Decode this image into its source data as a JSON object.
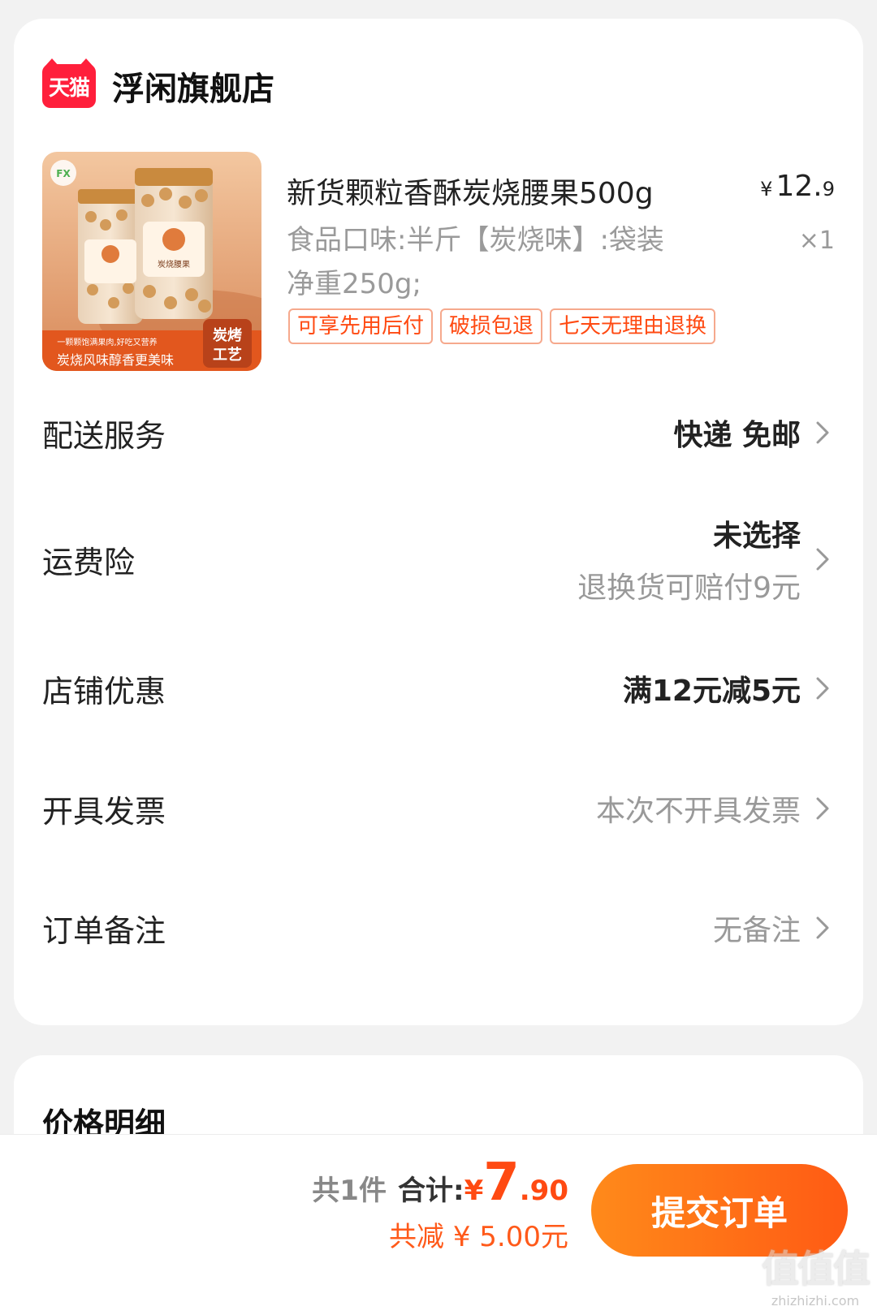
{
  "shop": {
    "badge": "天猫",
    "name": "浮闲旗舰店"
  },
  "product": {
    "title": "新货颗粒香酥炭烧腰果500g",
    "price": {
      "currency": "¥",
      "int": "12.",
      "dec": "9"
    },
    "spec": "食品口味:半斤【炭烧味】:袋装净重250g;",
    "qty": "×1",
    "tags": [
      "可享先用后付",
      "破损包退",
      "七天无理由退换"
    ],
    "image": {
      "jar_label": "炭烧腰果",
      "banner_top": "一颗颗饱满果肉,好吃又营养",
      "banner_bottom": "炭烧风味醇香更美味",
      "badge_line1": "炭烤",
      "badge_line2": "工艺",
      "logo_text": "FX"
    }
  },
  "rows": {
    "delivery": {
      "label": "配送服务",
      "value": "快递 免邮"
    },
    "insurance": {
      "label": "运费险",
      "value": "未选择",
      "sub": "退换货可赔付9元"
    },
    "coupon": {
      "label": "店铺优惠",
      "value": "满12元减5元"
    },
    "invoice": {
      "label": "开具发票",
      "value": "本次不开具发票"
    },
    "note": {
      "label": "订单备注",
      "value": "无备注"
    }
  },
  "price_detail": {
    "title": "价格明细"
  },
  "footer": {
    "count": "共1件",
    "total_label": "合计:",
    "currency": "¥",
    "total_int": "7",
    "total_dec": ".90",
    "discount": "共减 ¥ 5.00元",
    "submit": "提交订单"
  },
  "watermark": {
    "big": "值值值",
    "small": "zhizhizhi.com"
  },
  "colors": {
    "accent": "#ff4a12",
    "tmall_red": "#ff1f3b",
    "button_from": "#ff8a1a",
    "button_to": "#ff5a14"
  }
}
